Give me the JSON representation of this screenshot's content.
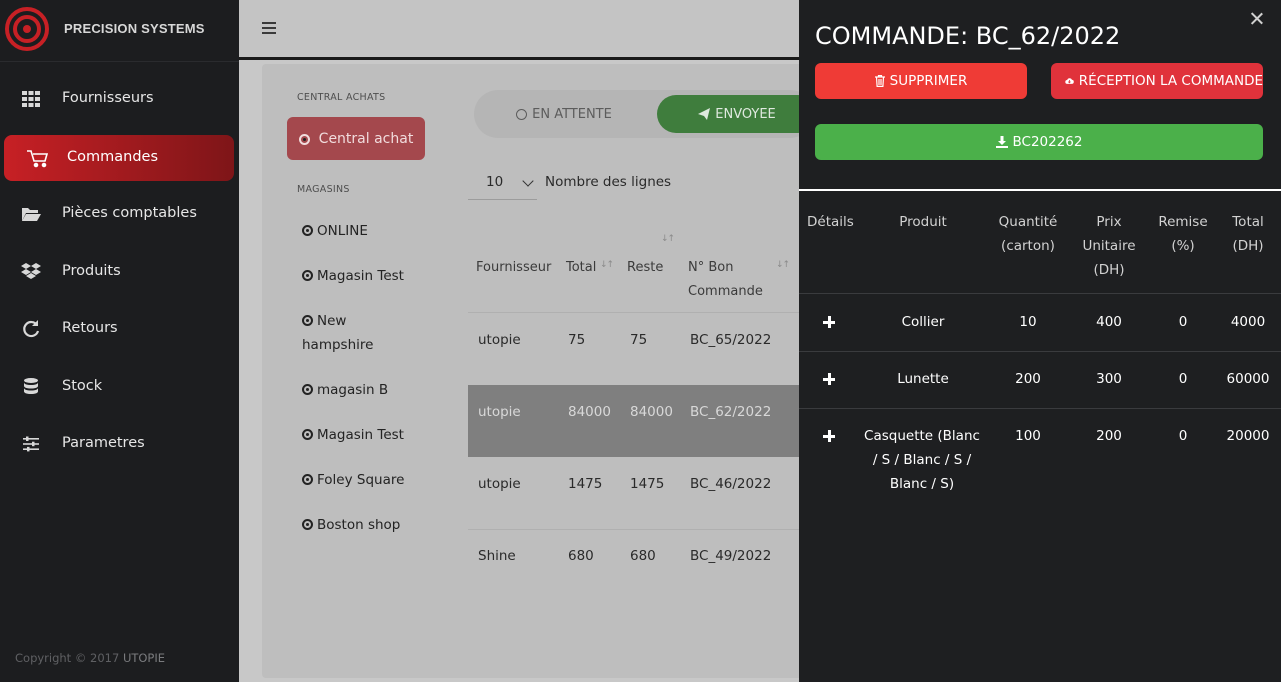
{
  "brand": {
    "name": "PRECISION SYSTEMS",
    "accent": "#c72025"
  },
  "sidebar": {
    "items": [
      {
        "label": "Fournisseurs",
        "icon": "grid-icon"
      },
      {
        "label": "Commandes",
        "icon": "cart-icon",
        "active": true
      },
      {
        "label": "Pièces comptables",
        "icon": "folder-open-icon"
      },
      {
        "label": "Produits",
        "icon": "dropbox-icon"
      },
      {
        "label": "Retours",
        "icon": "refresh-icon"
      },
      {
        "label": "Stock",
        "icon": "database-icon"
      },
      {
        "label": "Parametres",
        "icon": "sliders-icon"
      }
    ],
    "copyright": "Copyright © 2017",
    "copyright_brand": "UTOPIE"
  },
  "main": {
    "central_section_label": "CENTRAL ACHATS",
    "central_button": "Central achat",
    "stores_section_label": "MAGASINS",
    "stores": [
      "ONLINE",
      "Magasin Test",
      "New hampshire",
      "magasin B",
      "Magasin Test",
      "Foley Square",
      "Boston shop"
    ],
    "tabs": {
      "waiting": "EN ATTENTE",
      "sent": "ENVOYEE"
    },
    "page_size": "10",
    "page_size_label": "Nombre des lignes",
    "table": {
      "headers": [
        "Fournisseur",
        "Total",
        "Reste",
        "N° Bon Commande"
      ],
      "rows": [
        [
          "utopie",
          "75",
          "75",
          "BC_65/2022"
        ],
        [
          "utopie",
          "84000",
          "84000",
          "BC_62/2022"
        ],
        [
          "utopie",
          "1475",
          "1475",
          "BC_46/2022"
        ],
        [
          "Shine",
          "680",
          "680",
          "BC_49/2022"
        ]
      ],
      "selected_row": 1
    }
  },
  "drawer": {
    "title": "COMMANDE: BC_62/2022",
    "delete_label": "SUPPRIMER",
    "receive_label": "RÉCEPTION LA COMMANDE",
    "download_label": "BC202262",
    "headers": {
      "details": "Détails",
      "product": "Produit",
      "quantity": "Quantité (carton)",
      "unit_price": "Prix Unitaire (DH)",
      "discount": "Remise (%)",
      "total": "Total (DH)"
    },
    "lines": [
      {
        "product": "Collier",
        "quantity": "10",
        "unit_price": "400",
        "discount": "0",
        "total": "4000"
      },
      {
        "product": "Lunette",
        "quantity": "200",
        "unit_price": "300",
        "discount": "0",
        "total": "60000"
      },
      {
        "product": "Casquette (Blanc / S / Blanc / S / Blanc / S)",
        "quantity": "100",
        "unit_price": "200",
        "discount": "0",
        "total": "20000"
      }
    ]
  }
}
